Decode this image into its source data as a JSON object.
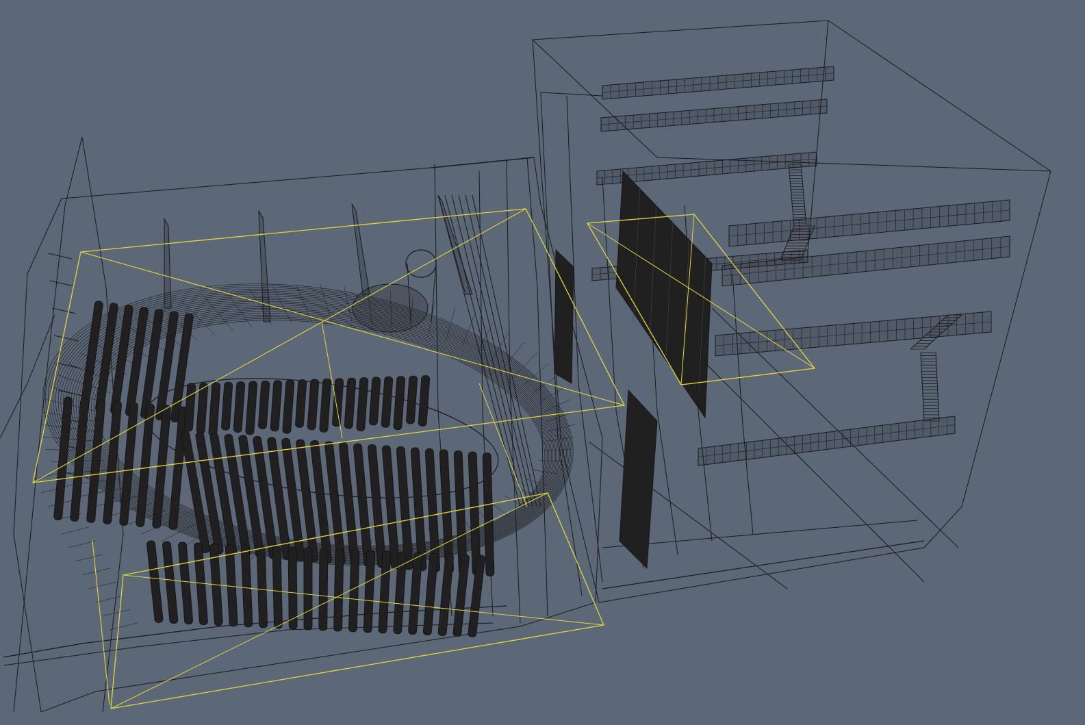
{
  "viewport": {
    "name": "3d-wireframe-viewport",
    "background": "#5c6777",
    "wire_color": "#1a1a1a",
    "dense_fill": "#202020",
    "selection_color": "#e6d63a"
  }
}
